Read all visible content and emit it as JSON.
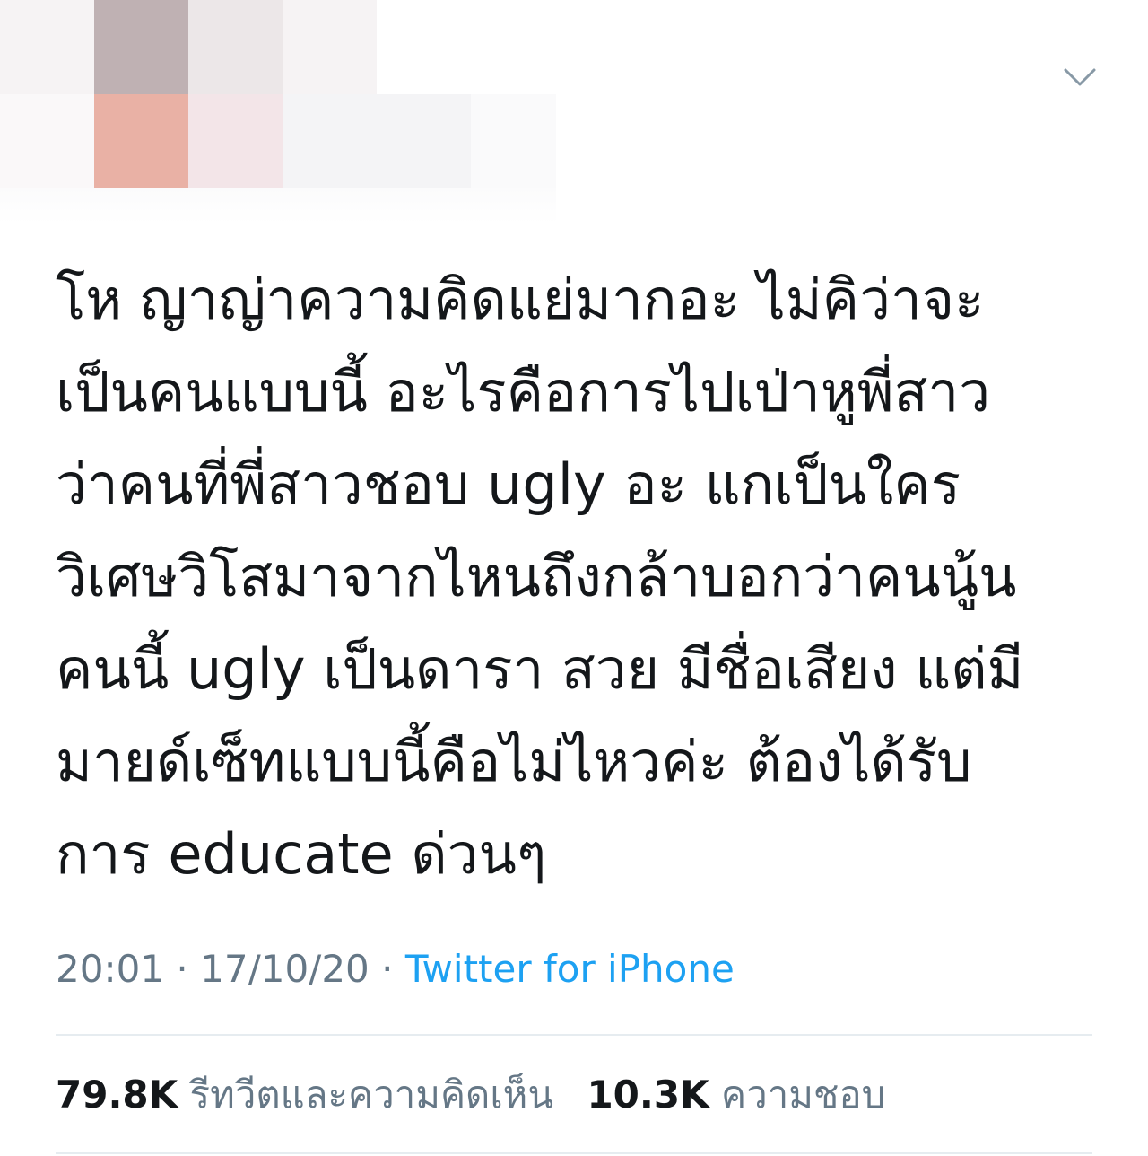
{
  "header": {
    "author_display": "",
    "menu_icon": "chevron-down-icon"
  },
  "tweet": {
    "text": "โห ญาญ่าความคิดแย่มากอะ ไม่คิว่าจะ\nเป็นคนแบบนี้ อะไรคือการไปเป่าหูพี่สาว\nว่าคนที่พี่สาวชอบ ugly อะ แกเป็นใคร\nวิเศษวิโสมาจากไหนถึงกล้าบอกว่าคนนู้น\nคนนี้ ugly เป็นดารา สวย มีชื่อเสียง แต่มี\nมายด์เซ็ทแบบนี้คือไม่ไหวค่ะ ต้องได้รับ\nการ educate ด่วนๆ",
    "time": "20:01",
    "date": "17/10/20",
    "separator": "·",
    "source": "Twitter for iPhone"
  },
  "stats": {
    "retweets_count": "79.8K",
    "retweets_label": "รีทวีตและความคิดเห็น",
    "likes_count": "10.3K",
    "likes_label": "ความชอบ"
  },
  "colors": {
    "text": "#14171a",
    "secondary": "#657786",
    "link": "#1da1f2",
    "divider": "#e6ecf0"
  }
}
